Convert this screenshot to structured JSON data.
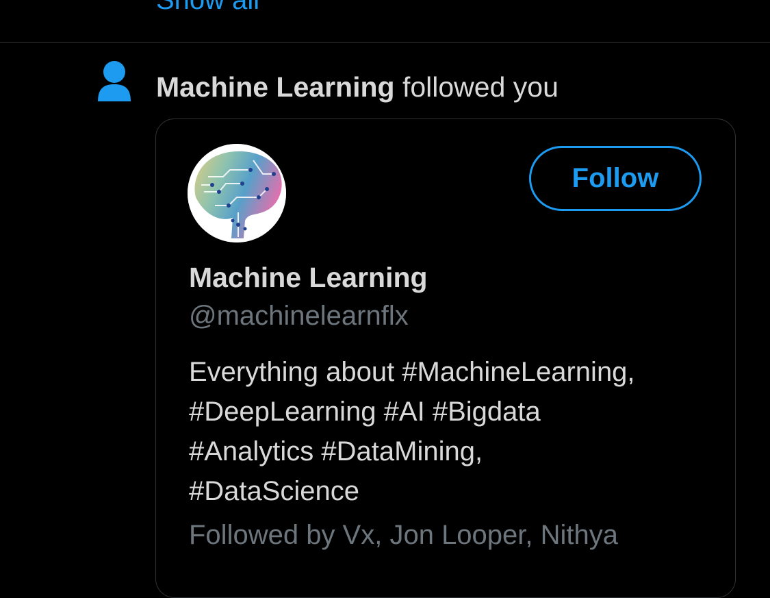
{
  "colors": {
    "background": "#000000",
    "accent": "#1d9bf0",
    "primary_text": "#d9d9d9",
    "secondary_text": "#6e767d",
    "border": "#2f3336"
  },
  "previous_section": {
    "show_all_label": "Show all"
  },
  "notification": {
    "icon": "person-icon",
    "actor_name": "Machine Learning",
    "action_text": "followed you"
  },
  "profile_card": {
    "avatar_icon": "brain-circuit-avatar",
    "follow_button_label": "Follow",
    "display_name": "Machine Learning",
    "handle": "@machinelearnflx",
    "bio_lines": [
      "Everything about #MachineLearning,",
      "#DeepLearning #AI #Bigdata",
      "#Analytics #DataMining,",
      "#DataScience"
    ],
    "followed_by": "Followed by Vx, Jon Looper, Nithya"
  }
}
